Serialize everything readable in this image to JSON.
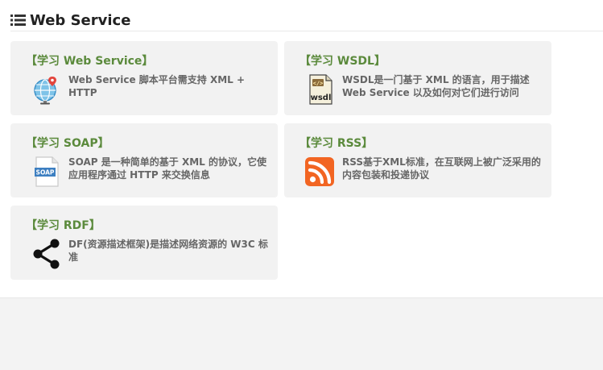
{
  "header": {
    "title": "Web Service",
    "icon": "list-icon"
  },
  "cards": [
    {
      "title": "【学习 Web Service】",
      "desc": "Web Service 脚本平台需支持 XML + HTTP",
      "icon": "globe-pin-icon"
    },
    {
      "title": "【学习 WSDL】",
      "desc": "WSDL是一门基于 XML 的语言，用于描述 Web Service 以及如何对它们进行访问",
      "icon": "wsdl-file-icon"
    },
    {
      "title": "【学习 SOAP】",
      "desc": "SOAP 是一种简单的基于 XML 的协议，它使应用程序通过 HTTP 来交换信息",
      "icon": "soap-file-icon"
    },
    {
      "title": "【学习 RSS】",
      "desc": "RSS基于XML标准，在互联网上被广泛采用的内容包装和投递协议",
      "icon": "rss-icon"
    },
    {
      "title": "【学习 RDF】",
      "desc": "DF(资源描述框架)是描述网络资源的 W3C 标准",
      "icon": "share-icon"
    }
  ],
  "colors": {
    "card_title": "#5b8a3c",
    "card_bg": "#f2f2f2",
    "rss_orange": "#f26522"
  }
}
